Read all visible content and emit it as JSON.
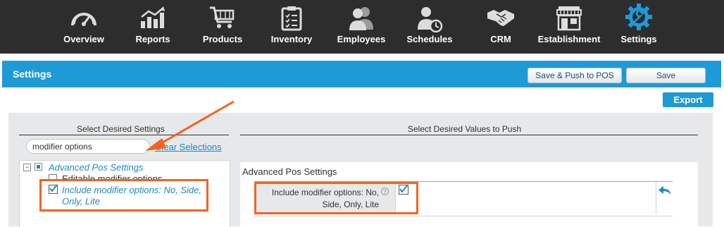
{
  "nav": {
    "items": [
      {
        "label": "Overview",
        "icon": "gauge-icon"
      },
      {
        "label": "Reports",
        "icon": "bar-chart-icon"
      },
      {
        "label": "Products",
        "icon": "shopping-cart-icon"
      },
      {
        "label": "Inventory",
        "icon": "clipboard-icon"
      },
      {
        "label": "Employees",
        "icon": "people-icon"
      },
      {
        "label": "Schedules",
        "icon": "person-clock-icon"
      },
      {
        "label": "CRM",
        "icon": "handshake-icon"
      },
      {
        "label": "Establishment",
        "icon": "storefront-icon"
      },
      {
        "label": "Settings",
        "icon": "gear-wrench-icon",
        "active": true
      }
    ]
  },
  "header": {
    "title": "Settings",
    "save_push_label": "Save & Push to POS",
    "save_label": "Save"
  },
  "export_label": "Export",
  "left_panel": {
    "title": "Select Desired Settings",
    "search_value": "modifier options",
    "clear_label": "Clear Selections",
    "tree": {
      "group_label": "Advanced Pos Settings",
      "item_editable": "Editable modifier options",
      "item_include": "Include modifier options: No, Side, Only, Lite",
      "item_include_checked": true
    }
  },
  "right_panel": {
    "title": "Select Desired Values to Push",
    "section_label": "Advanced Pos Settings",
    "row_label": "Include modifier options: No, Side, Only, Lite",
    "row_checked": true
  },
  "colors": {
    "nav_bg": "#2d2d2d",
    "accent": "#1e9ad6",
    "highlight": "#f26422",
    "link": "#1e88c7"
  }
}
